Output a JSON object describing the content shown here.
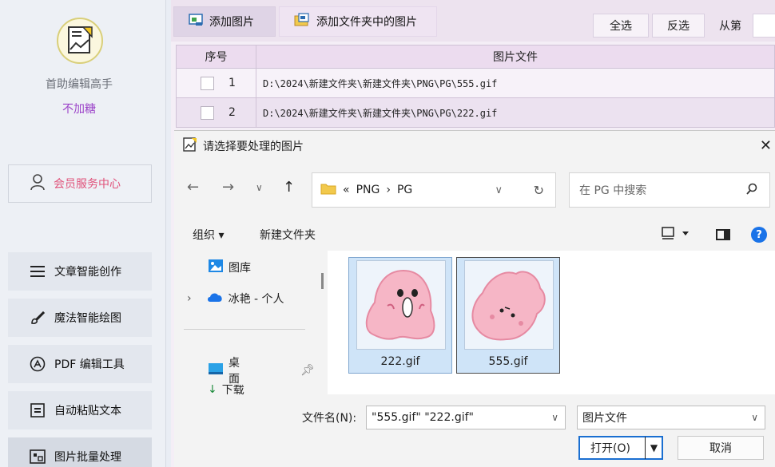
{
  "sidebar": {
    "logo_icon": "chart-document-icon",
    "app_name": "首助编辑高手",
    "app_subtitle": "不加糖",
    "member_center": "会员服务中心",
    "items": [
      {
        "label": "文章智能创作",
        "icon": "menu-lines-icon"
      },
      {
        "label": "魔法智能绘图",
        "icon": "paint-brush-icon"
      },
      {
        "label": "PDF 编辑工具",
        "icon": "pdf-tool-icon"
      },
      {
        "label": "自动粘贴文本",
        "icon": "paste-text-icon"
      },
      {
        "label": "图片批量处理",
        "icon": "image-batch-icon",
        "active": true
      }
    ]
  },
  "toolbar": {
    "add_image": "添加图片",
    "add_folder_images": "添加文件夹中的图片",
    "select_all": "全选",
    "invert_selection": "反选",
    "from_label": "从第"
  },
  "table": {
    "headers": {
      "number": "序号",
      "file": "图片文件"
    },
    "rows": [
      {
        "number": "1",
        "path": "D:\\2024\\新建文件夹\\新建文件夹\\PNG\\PG\\555.gif"
      },
      {
        "number": "2",
        "path": "D:\\2024\\新建文件夹\\新建文件夹\\PNG\\PG\\222.gif"
      }
    ]
  },
  "dialog": {
    "title": "请选择要处理的图片",
    "address": {
      "prefix": "«",
      "segments": [
        "PNG",
        "PG"
      ],
      "separator": "›"
    },
    "search_placeholder": "在 PG 中搜索",
    "organize": "组织 ▾",
    "new_folder": "新建文件夹",
    "nav_items": [
      {
        "label": "图库",
        "icon": "gallery-icon"
      },
      {
        "label": "冰艳 - 个人",
        "icon": "cloud-icon"
      },
      {
        "label": "桌面",
        "icon": "desktop-icon"
      },
      {
        "label": "下载",
        "icon": "download-icon"
      }
    ],
    "files": [
      {
        "name": "222.gif"
      },
      {
        "name": "555.gif"
      }
    ],
    "filename_label": "文件名(N):",
    "filename_value": "\"555.gif\" \"222.gif\"",
    "filetype": "图片文件",
    "open_button": "打开(O)",
    "cancel_button": "取消"
  },
  "colors": {
    "accent_blue": "#1a73e8",
    "member_pink": "#e0527a",
    "subtitle_purple": "#9c44c9",
    "selection_blue": "#cfe4f8"
  }
}
